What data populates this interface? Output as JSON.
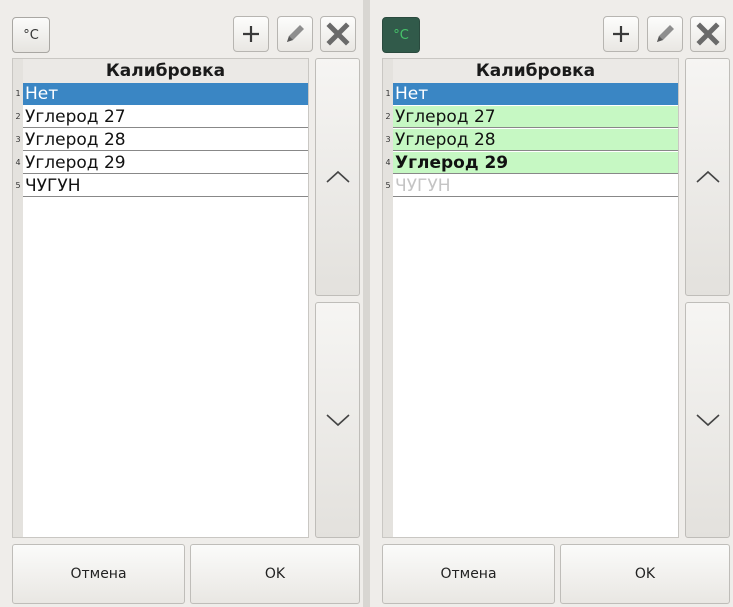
{
  "unit_button_label": "°C",
  "panels": [
    {
      "header": "Калибровка",
      "rows": [
        {
          "num": "1",
          "label": "Нет"
        },
        {
          "num": "2",
          "label": "Углерод 27"
        },
        {
          "num": "3",
          "label": "Углерод 28"
        },
        {
          "num": "4",
          "label": "Углерод 29"
        },
        {
          "num": "5",
          "label": "ЧУГУН"
        }
      ],
      "cancel_label": "Отмена",
      "ok_label": "OK"
    },
    {
      "header": "Калибровка",
      "rows": [
        {
          "num": "1",
          "label": "Нет"
        },
        {
          "num": "2",
          "label": "Углерод 27"
        },
        {
          "num": "3",
          "label": "Углерод 28"
        },
        {
          "num": "4",
          "label": "Углерод 29"
        },
        {
          "num": "5",
          "label": "ЧУГУН"
        }
      ],
      "cancel_label": "Отмена",
      "ok_label": "OK"
    }
  ],
  "colors": {
    "selected_row": "#3a86c4",
    "highlight_row": "#c6f8c3",
    "disabled_text": "#c4c4c4",
    "active_unit_button": "#315a4a",
    "active_unit_text": "#46c46a"
  },
  "icons": {
    "add": "plus-icon",
    "edit": "pencil-icon",
    "delete": "x-icon",
    "scroll_up": "chevron-up-icon",
    "scroll_down": "chevron-down-icon"
  }
}
